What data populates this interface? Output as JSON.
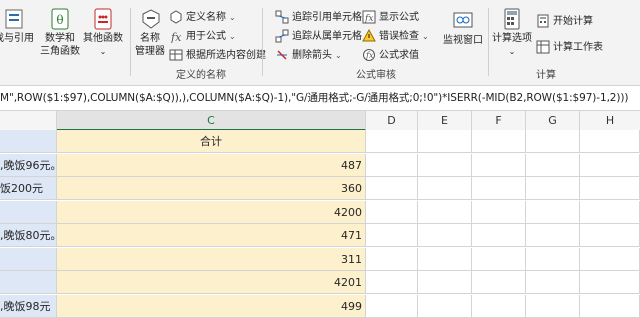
{
  "ribbon": {
    "function_library": {
      "lookup_ref_label_line1": "找与引用",
      "lookup_ref_label_line2": "",
      "math_label_line1": "数学和",
      "math_label_line2": "三角函数",
      "more_label": "其他函数"
    },
    "defined_names": {
      "name_manager_line1": "名称",
      "name_manager_line2": "管理器",
      "define_name": "定义名称",
      "use_in_formula": "用于公式",
      "create_from_selection": "根据所选内容创建",
      "group_label": "定义的名称"
    },
    "formula_auditing": {
      "trace_precedents": "追踪引用单元格",
      "trace_dependents": "追踪从属单元格",
      "remove_arrows": "删除箭头",
      "show_formulas": "显示公式",
      "error_checking": "错误检查",
      "evaluate_formula": "公式求值",
      "watch_window_line1": "监视窗口",
      "group_label": "公式审核"
    },
    "calculation": {
      "calc_options_line1": "计算选项",
      "calc_now": "开始计算",
      "calc_sheet": "计算工作表",
      "group_label": "计算"
    }
  },
  "formula_bar": {
    "text": "M\",ROW($1:$97),COLUMN($A:$Q)),),COLUMN($A:$Q)-1),\"G/通用格式;-G/通用格式;0;!0\")*ISERR(-MID(B2,ROW($1:$97)-1,2)))"
  },
  "columns": [
    "C",
    "D",
    "E",
    "F",
    "G",
    "H"
  ],
  "rows": [
    {
      "b": "",
      "c": "合计"
    },
    {
      "b": ",晚饭96元。",
      "c": "487"
    },
    {
      "b": "饭200元",
      "c": "360"
    },
    {
      "b": "",
      "c": "4200"
    },
    {
      "b": ",晚饭80元。",
      "c": "471"
    },
    {
      "b": "",
      "c": "311"
    },
    {
      "b": "",
      "c": "4201"
    },
    {
      "b": ",晚饭98元",
      "c": "499"
    }
  ],
  "colors": {
    "b_column": "#dde7f5",
    "c_column": "#fdf0cd",
    "accent": "#217346"
  }
}
